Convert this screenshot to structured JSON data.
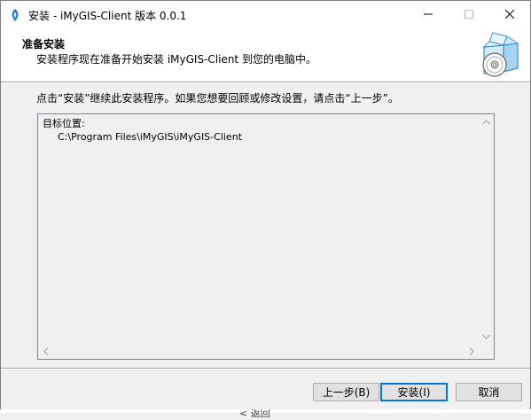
{
  "window": {
    "title": "安装 - iMyGIS-Client 版本 0.0.1",
    "icon": "app-logo-icon"
  },
  "titlebar_buttons": {
    "minimize": "minimize-icon",
    "maximize": "maximize-icon",
    "close": "close-icon"
  },
  "header": {
    "title": "准备安装",
    "subtitle": "安装程序现在准备开始安装 iMyGIS-Client 到您的电脑中。",
    "graphic": "installer-box-cd-icon"
  },
  "instruction": "点击“安装”继续此安装程序。如果您想要回顾或修改设置，请点击“上一步”。",
  "memo": {
    "line1": "目标位置:",
    "line2": "C:\\Program Files\\iMyGIS\\iMyGIS-Client"
  },
  "buttons": {
    "back": "上一步(B)",
    "install": "安装(I)",
    "cancel": "取消"
  },
  "background_text": "< 返回"
}
